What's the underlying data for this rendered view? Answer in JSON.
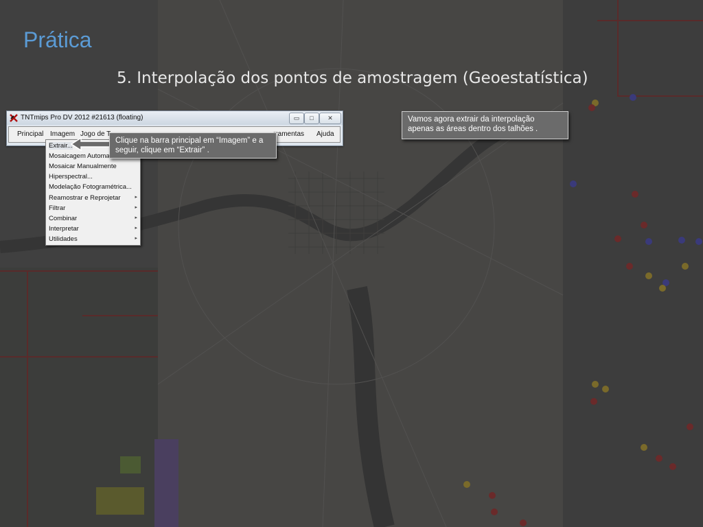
{
  "slide": {
    "title": "Prática",
    "subtitle": "5. Interpolação dos pontos de amostragem (Geoestatística)"
  },
  "window": {
    "title": "TNTmips Pro DV 2012  #21613 (floating)",
    "app_icon": "tntmips-icon",
    "controls": {
      "minimize": "▭",
      "maximize": "□",
      "close": "✕"
    }
  },
  "menubar": {
    "principal": "Principal",
    "imagem": "Imagem",
    "jogo": "Jogo de T",
    "ferramentas": "rramentas",
    "ajuda": "Ajuda"
  },
  "dropdown": {
    "items": [
      {
        "label": "Extrair...",
        "submenu": false
      },
      {
        "label": "Mosaicagem Automa",
        "submenu": false
      },
      {
        "label": "Mosaicar Manualmente",
        "submenu": false
      },
      {
        "label": "Hiperspectral...",
        "submenu": false
      },
      {
        "label": "Modelação Fotogramétrica...",
        "submenu": false
      },
      {
        "label": "Reamostrar e Reprojetar",
        "submenu": true
      },
      {
        "label": "Filtrar",
        "submenu": true
      },
      {
        "label": "Combinar",
        "submenu": true
      },
      {
        "label": "Interpretar",
        "submenu": true
      },
      {
        "label": "Utilidades",
        "submenu": true
      }
    ],
    "submenu_marker": "▸"
  },
  "callouts": {
    "left": "Clique na barra principal em “Imagem” e a seguir, clique em “Extrair” .",
    "right": "Vamos agora extrair da interpolação apenas as áreas dentro dos talhões ."
  },
  "colors": {
    "title": "#5b9bd5",
    "callout_bg": "#6b6b6b",
    "background": "#3b3b3b"
  }
}
